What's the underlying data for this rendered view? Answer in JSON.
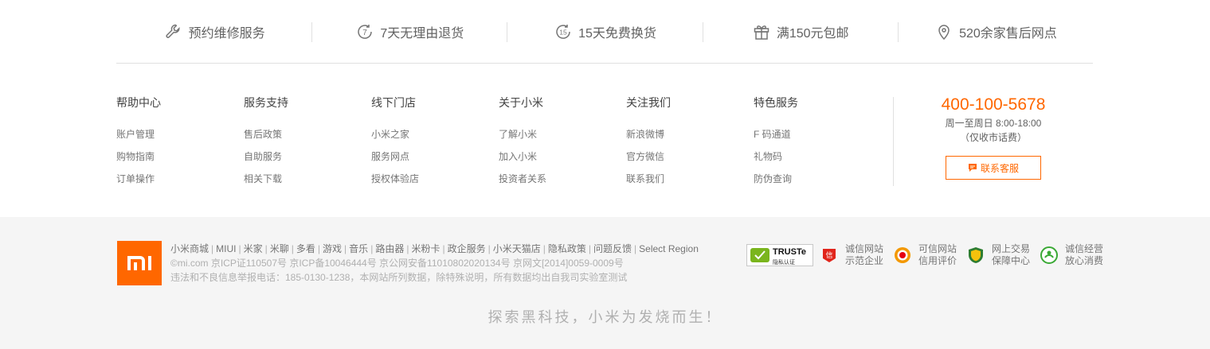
{
  "services": [
    {
      "icon": "wrench-icon",
      "label": "预约维修服务"
    },
    {
      "icon": "seven-day-return-icon",
      "label": "7天无理由退货",
      "badge": "7"
    },
    {
      "icon": "fifteen-day-exchange-icon",
      "label": "15天免费换货",
      "badge": "15"
    },
    {
      "icon": "gift-icon",
      "label": "满150元包邮"
    },
    {
      "icon": "location-pin-icon",
      "label": "520余家售后网点"
    }
  ],
  "columns": [
    {
      "title": "帮助中心",
      "links": [
        "账户管理",
        "购物指南",
        "订单操作"
      ]
    },
    {
      "title": "服务支持",
      "links": [
        "售后政策",
        "自助服务",
        "相关下载"
      ]
    },
    {
      "title": "线下门店",
      "links": [
        "小米之家",
        "服务网点",
        "授权体验店"
      ]
    },
    {
      "title": "关于小米",
      "links": [
        "了解小米",
        "加入小米",
        "投资者关系"
      ]
    },
    {
      "title": "关注我们",
      "links": [
        "新浪微博",
        "官方微信",
        "联系我们"
      ]
    },
    {
      "title": "特色服务",
      "links": [
        "F 码通道",
        "礼物码",
        "防伪查询"
      ]
    }
  ],
  "contact": {
    "phone": "400-100-5678",
    "hours_line1": "周一至周日 8:00-18:00",
    "hours_line2": "（仅收市话费）",
    "service_button": "联系客服"
  },
  "bottom": {
    "logo_text": "mi",
    "site_links": [
      "小米商城",
      "MIUI",
      "米家",
      "米聊",
      "多看",
      "游戏",
      "音乐",
      "路由器",
      "米粉卡",
      "政企服务",
      "小米天猫店",
      "隐私政策",
      "问题反馈",
      "Select Region"
    ],
    "copyright": "©mi.com 京ICP证110507号 京ICP备10046444号 京公网安备11010802020134号 京网文[2014]0059-0009号",
    "report_line": "违法和不良信息举报电话：185-0130-1238，本网站所列数据，除特殊说明，所有数据均出自我司实验室测试",
    "truste": {
      "title": "TRUSTe",
      "sub": "隐私认证"
    },
    "badges": [
      {
        "icon": "credit-xin-icon",
        "line1": "诚信网站",
        "line2": "示范企业"
      },
      {
        "icon": "trusted-site-icon",
        "line1": "可信网站",
        "line2": "信用评价"
      },
      {
        "icon": "trade-shield-icon",
        "line1": "网上交易",
        "line2": "保障中心"
      },
      {
        "icon": "integrity-icon",
        "line1": "诚信经营",
        "line2": "放心消费"
      }
    ],
    "slogan": "探索黑科技，小米为发烧而生！"
  },
  "colors": {
    "accent": "#ff6700",
    "text": "#424242",
    "muted": "#757575",
    "bg_bottom": "#f5f5f5"
  }
}
